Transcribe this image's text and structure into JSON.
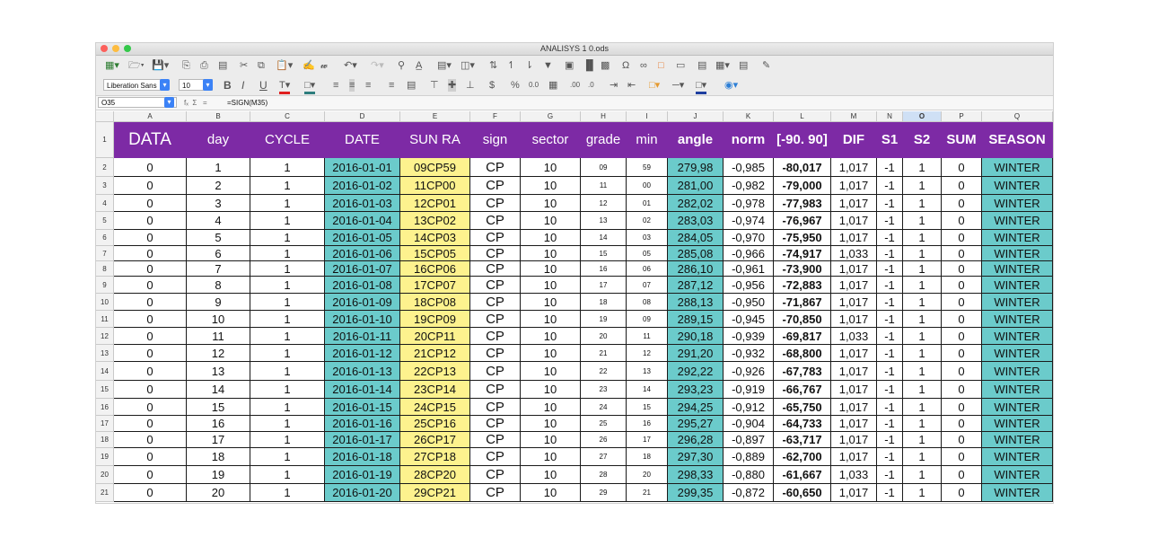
{
  "window": {
    "title": "ANALISYS 1 0.ods"
  },
  "toolbar": {
    "font_name": "Liberation Sans",
    "font_size": "10",
    "bold": "B",
    "italic": "I",
    "underline": "U",
    "currency": "$",
    "percent": "%",
    "number_format": "0.0"
  },
  "formula_bar": {
    "cell_ref": "O35",
    "fx": "fₓ",
    "sigma": "Σ",
    "equals": "=",
    "formula": "=SIGN(M35)"
  },
  "columns": [
    "A",
    "B",
    "C",
    "D",
    "E",
    "F",
    "G",
    "H",
    "I",
    "J",
    "K",
    "L",
    "M",
    "N",
    "O",
    "P",
    "Q"
  ],
  "selected_column": "O",
  "header_row": {
    "row_num": "1",
    "cells": [
      "DATA",
      "day",
      "CYCLE",
      "DATE",
      "SUN RA",
      "sign",
      "sector",
      "grade",
      "min",
      "angle",
      "norm",
      "[-90. 90]",
      "DIF",
      "S1",
      "S2",
      "SUM",
      "SEASON"
    ]
  },
  "rows": [
    {
      "n": "2",
      "c": [
        "0",
        "1",
        "1",
        "2016-01-01",
        "09CP59",
        "CP",
        "10",
        "09",
        "59",
        "279,98",
        "-0,985",
        "-80,017",
        "1,017",
        "-1",
        "1",
        "0",
        "WINTER"
      ]
    },
    {
      "n": "3",
      "c": [
        "0",
        "2",
        "1",
        "2016-01-02",
        "11CP00",
        "CP",
        "10",
        "11",
        "00",
        "281,00",
        "-0,982",
        "-79,000",
        "1,017",
        "-1",
        "1",
        "0",
        "WINTER"
      ]
    },
    {
      "n": "4",
      "c": [
        "0",
        "3",
        "1",
        "2016-01-03",
        "12CP01",
        "CP",
        "10",
        "12",
        "01",
        "282,02",
        "-0,978",
        "-77,983",
        "1,017",
        "-1",
        "1",
        "0",
        "WINTER"
      ]
    },
    {
      "n": "5",
      "c": [
        "0",
        "4",
        "1",
        "2016-01-04",
        "13CP02",
        "CP",
        "10",
        "13",
        "02",
        "283,03",
        "-0,974",
        "-76,967",
        "1,017",
        "-1",
        "1",
        "0",
        "WINTER"
      ]
    },
    {
      "n": "6",
      "c": [
        "0",
        "5",
        "1",
        "2016-01-05",
        "14CP03",
        "CP",
        "10",
        "14",
        "03",
        "284,05",
        "-0,970",
        "-75,950",
        "1,017",
        "-1",
        "1",
        "0",
        "WINTER"
      ]
    },
    {
      "n": "7",
      "c": [
        "0",
        "6",
        "1",
        "2016-01-06",
        "15CP05",
        "CP",
        "10",
        "15",
        "05",
        "285,08",
        "-0,966",
        "-74,917",
        "1,033",
        "-1",
        "1",
        "0",
        "WINTER"
      ]
    },
    {
      "n": "8",
      "c": [
        "0",
        "7",
        "1",
        "2016-01-07",
        "16CP06",
        "CP",
        "10",
        "16",
        "06",
        "286,10",
        "-0,961",
        "-73,900",
        "1,017",
        "-1",
        "1",
        "0",
        "WINTER"
      ]
    },
    {
      "n": "9",
      "c": [
        "0",
        "8",
        "1",
        "2016-01-08",
        "17CP07",
        "CP",
        "10",
        "17",
        "07",
        "287,12",
        "-0,956",
        "-72,883",
        "1,017",
        "-1",
        "1",
        "0",
        "WINTER"
      ]
    },
    {
      "n": "10",
      "c": [
        "0",
        "9",
        "1",
        "2016-01-09",
        "18CP08",
        "CP",
        "10",
        "18",
        "08",
        "288,13",
        "-0,950",
        "-71,867",
        "1,017",
        "-1",
        "1",
        "0",
        "WINTER"
      ]
    },
    {
      "n": "11",
      "c": [
        "0",
        "10",
        "1",
        "2016-01-10",
        "19CP09",
        "CP",
        "10",
        "19",
        "09",
        "289,15",
        "-0,945",
        "-70,850",
        "1,017",
        "-1",
        "1",
        "0",
        "WINTER"
      ]
    },
    {
      "n": "12",
      "c": [
        "0",
        "11",
        "1",
        "2016-01-11",
        "20CP11",
        "CP",
        "10",
        "20",
        "11",
        "290,18",
        "-0,939",
        "-69,817",
        "1,033",
        "-1",
        "1",
        "0",
        "WINTER"
      ]
    },
    {
      "n": "13",
      "c": [
        "0",
        "12",
        "1",
        "2016-01-12",
        "21CP12",
        "CP",
        "10",
        "21",
        "12",
        "291,20",
        "-0,932",
        "-68,800",
        "1,017",
        "-1",
        "1",
        "0",
        "WINTER"
      ]
    },
    {
      "n": "14",
      "c": [
        "0",
        "13",
        "1",
        "2016-01-13",
        "22CP13",
        "CP",
        "10",
        "22",
        "13",
        "292,22",
        "-0,926",
        "-67,783",
        "1,017",
        "-1",
        "1",
        "0",
        "WINTER"
      ]
    },
    {
      "n": "15",
      "c": [
        "0",
        "14",
        "1",
        "2016-01-14",
        "23CP14",
        "CP",
        "10",
        "23",
        "14",
        "293,23",
        "-0,919",
        "-66,767",
        "1,017",
        "-1",
        "1",
        "0",
        "WINTER"
      ]
    },
    {
      "n": "16",
      "c": [
        "0",
        "15",
        "1",
        "2016-01-15",
        "24CP15",
        "CP",
        "10",
        "24",
        "15",
        "294,25",
        "-0,912",
        "-65,750",
        "1,017",
        "-1",
        "1",
        "0",
        "WINTER"
      ]
    },
    {
      "n": "17",
      "c": [
        "0",
        "16",
        "1",
        "2016-01-16",
        "25CP16",
        "CP",
        "10",
        "25",
        "16",
        "295,27",
        "-0,904",
        "-64,733",
        "1,017",
        "-1",
        "1",
        "0",
        "WINTER"
      ]
    },
    {
      "n": "18",
      "c": [
        "0",
        "17",
        "1",
        "2016-01-17",
        "26CP17",
        "CP",
        "10",
        "26",
        "17",
        "296,28",
        "-0,897",
        "-63,717",
        "1,017",
        "-1",
        "1",
        "0",
        "WINTER"
      ]
    },
    {
      "n": "19",
      "c": [
        "0",
        "18",
        "1",
        "2016-01-18",
        "27CP18",
        "CP",
        "10",
        "27",
        "18",
        "297,30",
        "-0,889",
        "-62,700",
        "1,017",
        "-1",
        "1",
        "0",
        "WINTER"
      ]
    },
    {
      "n": "20",
      "c": [
        "0",
        "19",
        "1",
        "2016-01-19",
        "28CP20",
        "CP",
        "10",
        "28",
        "20",
        "298,33",
        "-0,880",
        "-61,667",
        "1,033",
        "-1",
        "1",
        "0",
        "WINTER"
      ]
    },
    {
      "n": "21",
      "c": [
        "0",
        "20",
        "1",
        "2016-01-20",
        "29CP21",
        "CP",
        "10",
        "29",
        "21",
        "299,35",
        "-0,872",
        "-60,650",
        "1,017",
        "-1",
        "1",
        "0",
        "WINTER"
      ]
    }
  ],
  "colors": {
    "header_bg": "#7d2aa5",
    "teal": "#6bcbcb",
    "yellow": "#fdf28e"
  }
}
